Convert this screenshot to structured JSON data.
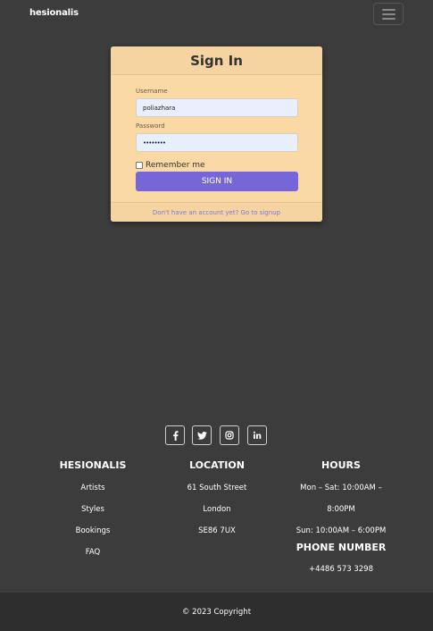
{
  "navbar": {
    "brand": "hesionalis",
    "menu_icon": "hamburger-menu-icon"
  },
  "signin": {
    "title": "Sign In",
    "username_label": "Username",
    "username_value": "poliazhara",
    "password_label": "Password",
    "password_value": "••••••••",
    "remember_label": "Remember me",
    "remember_checked": false,
    "submit_label": "SIGN IN",
    "signup_link": "Don't have an account yet? Go to signup"
  },
  "social": {
    "icons": [
      "facebook-icon",
      "twitter-icon",
      "instagram-icon",
      "linkedin-icon"
    ]
  },
  "footer": {
    "brand": {
      "title": "HESIONALIS",
      "links": [
        "Artists",
        "Styles",
        "Bookings",
        "FAQ"
      ]
    },
    "location": {
      "title": "LOCATION",
      "lines": [
        "61 South Street",
        "London",
        "SE86 7UX"
      ]
    },
    "hours": {
      "title": "HOURS",
      "lines": [
        "Mon – Sat: 10:00AM –",
        "8:00PM",
        "Sun: 10:00AM – 6:00PM"
      ]
    },
    "phone": {
      "title": "PHONE NUMBER",
      "number": "+4486 573 3298"
    },
    "copyright": "© 2023 Copyright"
  },
  "colors": {
    "page_background": "#3c3c3c",
    "card_background": "#fad9a5",
    "accent_button": "#7766d8",
    "link": "#7a78e0",
    "bottom_bar": "#2e2e2e"
  }
}
